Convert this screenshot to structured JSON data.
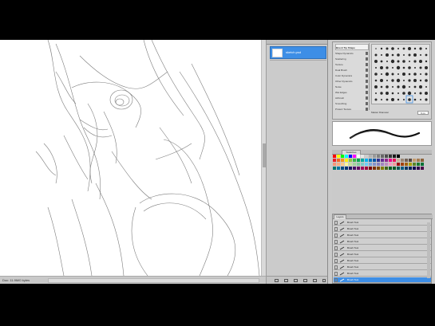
{
  "canvas": {
    "zoom_readout": "Doc: 11.9M/0 bytes"
  },
  "history": {
    "snapshot_label": "sketch.psd"
  },
  "brushes": {
    "list": [
      "Brush Tip Shape",
      "Shape Dynamics",
      "Scattering",
      "Texture",
      "Dual Brush",
      "Color Dynamics",
      "Other Dynamics",
      "Noise",
      "Wet Edges",
      "Airbrush",
      "Smoothing",
      "Protect Texture"
    ],
    "spacing_label": "Master Diameter",
    "spacing_value": "9 px"
  },
  "swatches": {
    "tab_label": "Swatches"
  },
  "layers": {
    "tab_label": "Layers",
    "items": [
      "Brush Tool",
      "Brush Tool",
      "Brush Tool",
      "Brush Tool",
      "Brush Tool",
      "Brush Tool",
      "Brush Tool",
      "Brush Tool",
      "Brush Tool",
      "Brush Tool",
      "Brush Tool"
    ]
  },
  "colors": {
    "accent": "#3d8ee6",
    "panel": "#cbcbcb"
  }
}
